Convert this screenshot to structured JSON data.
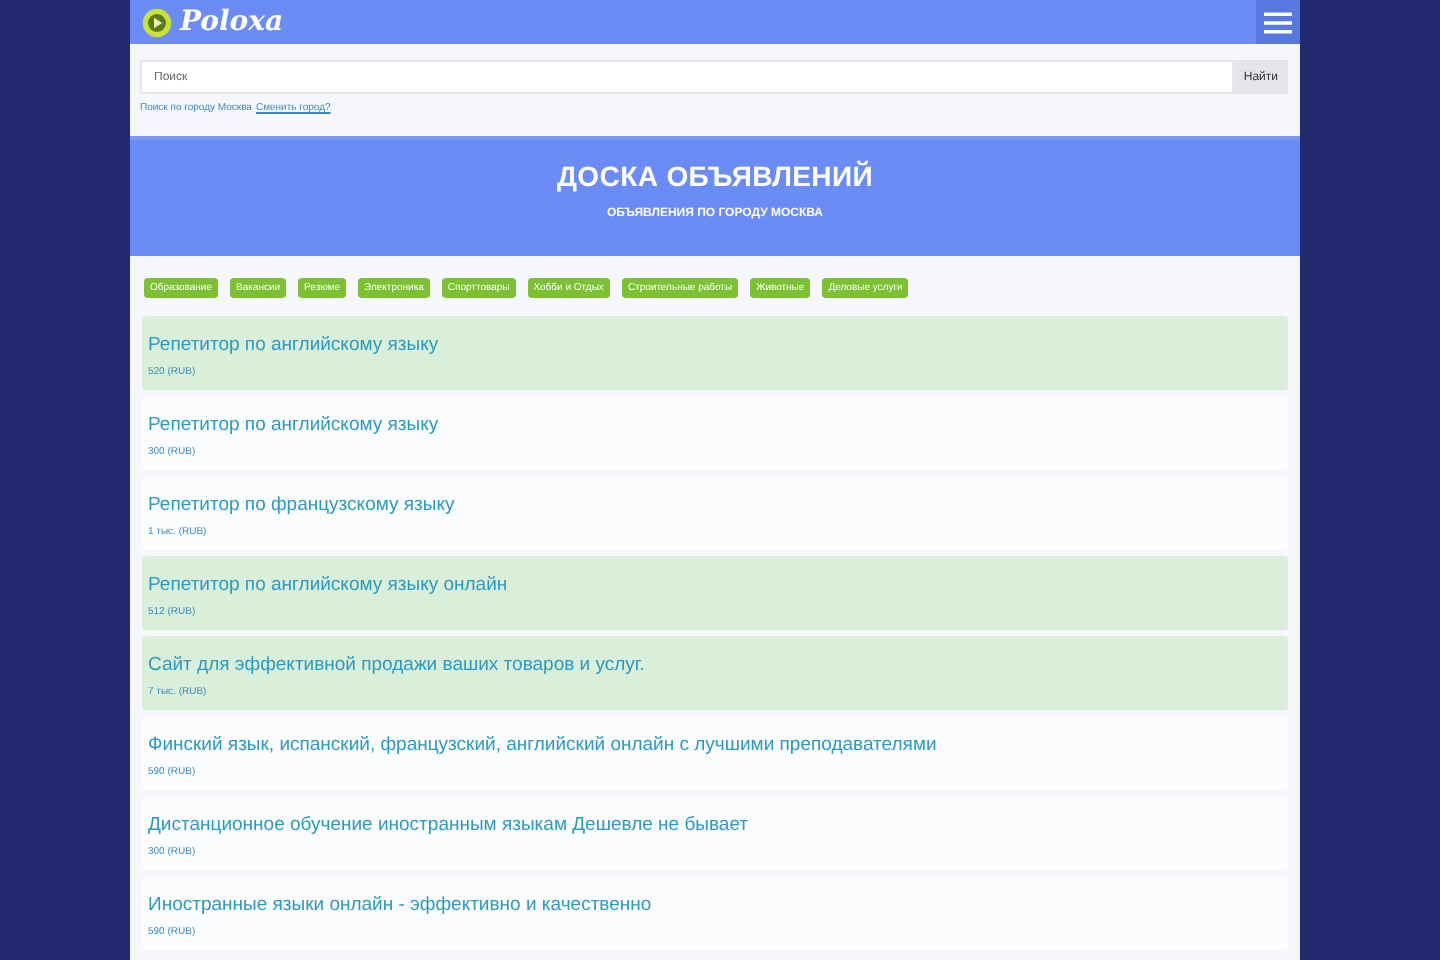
{
  "header": {
    "logo": "Poloxa"
  },
  "search": {
    "placeholder": "Поиск",
    "button": "Найти",
    "city_note": "Поиск по городу Москва",
    "change_city_link": "Сменить город?"
  },
  "banner": {
    "title": "ДОСКА ОБЪЯВЛЕНИЙ",
    "subtitle": "ОБЪЯВЛЕНИЯ ПО ГОРОДУ МОСКВА"
  },
  "categories": [
    "Образование",
    "Вакансии",
    "Резюме",
    "Электроника",
    "Спорттовары",
    "Хобби и Отдых",
    "Строительные работы",
    "Животные",
    "Деловые услуги"
  ],
  "listings": [
    {
      "title": "Репетитор по английскому языку",
      "price": "520 (RUB)",
      "highlighted": true
    },
    {
      "title": "Репетитор по английскому языку",
      "price": "300 (RUB)",
      "highlighted": false
    },
    {
      "title": "Репетитор по французскому языку",
      "price": "1 тыс. (RUB)",
      "highlighted": false
    },
    {
      "title": "Репетитор по английскому языку онлайн",
      "price": "512 (RUB)",
      "highlighted": true
    },
    {
      "title": "Сайт для эффективной продажи ваших товаров и услуг.",
      "price": "7 тыс. (RUB)",
      "highlighted": true
    },
    {
      "title": "Финский язык, испанский, французский, английский онлайн с лучшими преподавателями",
      "price": "590 (RUB)",
      "highlighted": false
    },
    {
      "title": "Дистанционное обучение иностранным языкам Дешевле не бывает",
      "price": "300 (RUB)",
      "highlighted": false
    },
    {
      "title": "Иностранные языки онлайн - эффективно и качественно",
      "price": "590 (RUB)",
      "highlighted": false
    }
  ]
}
